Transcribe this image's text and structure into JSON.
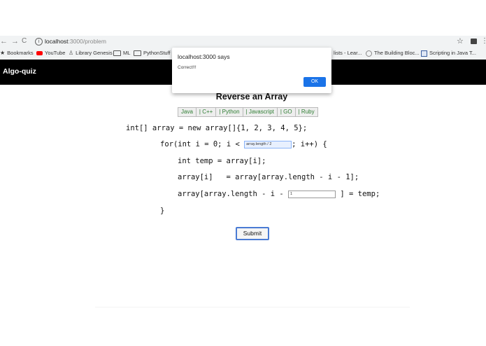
{
  "browser": {
    "back_glyph": "←",
    "forward_glyph": "→",
    "reload_glyph": "C",
    "info_glyph": "i",
    "url_host": "localhost",
    "url_rest": ":3000/problem",
    "star_glyph": "☆",
    "menu_glyph": "⋮"
  },
  "bookmarks": [
    {
      "label": "Bookmarks",
      "icon": "star-icon"
    },
    {
      "label": "YouTube",
      "icon": "youtube-icon"
    },
    {
      "label": "Library Genesis",
      "icon": "library-icon"
    },
    {
      "label": "ML",
      "icon": "folder-icon"
    },
    {
      "label": "PythonStuff",
      "icon": "folder-icon"
    },
    {
      "label": "lists - Lear...",
      "icon": "none"
    },
    {
      "label": "The Building Bloc...",
      "icon": "site-icon"
    },
    {
      "label": "Scripting in Java T...",
      "icon": "page-icon"
    }
  ],
  "app": {
    "brand": "Algo-quiz"
  },
  "problem": {
    "title": "Reverse an Array",
    "languages": [
      "Java",
      "| C++",
      "| Python",
      "| Javascript",
      "| GO",
      "| Ruby"
    ],
    "code": {
      "line1": "int[] array = new array[]{1, 2, 3, 4, 5};",
      "line2_prefix": "for(int i = 0; i < ",
      "line2_input": "array.length / 2",
      "line2_suffix": "; i++) {",
      "line3": "int temp = array[i];",
      "line4": "array[i]   = array[array.length - i - 1];",
      "line5_prefix": "array[array.length - i - ",
      "line5_input": "1",
      "line5_suffix": " ] = temp;",
      "line6": "}"
    },
    "submit_label": "Submit"
  },
  "dialog": {
    "origin": "localhost:3000 says",
    "message": "Correct!!!",
    "ok_label": "OK"
  },
  "colors": {
    "header_bg": "#000000",
    "lang_text": "#2e7d32",
    "dialog_button": "#1a73e8",
    "submit_border": "#4a7bd4"
  }
}
